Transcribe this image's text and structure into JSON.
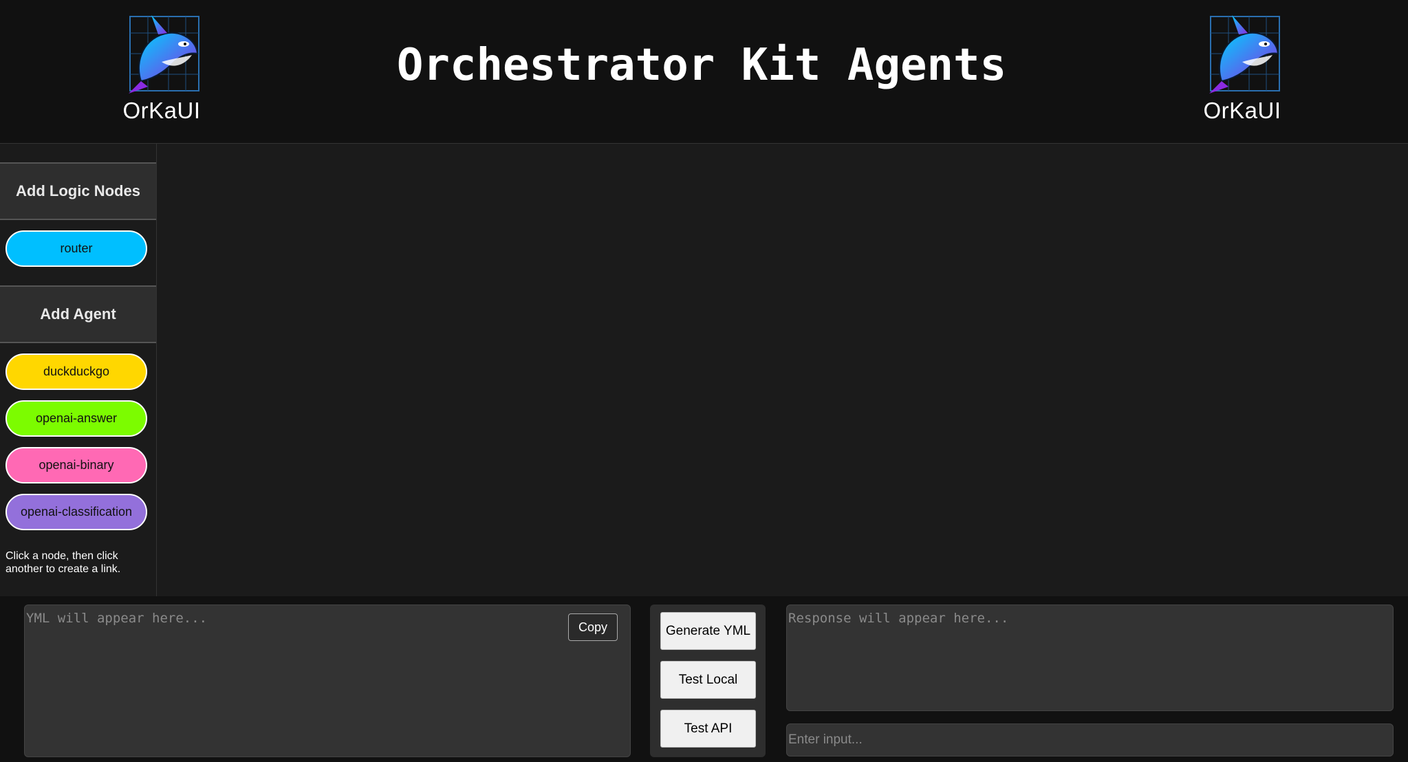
{
  "header": {
    "title": "Orchestrator Kit Agents",
    "logo_text": "OrKaUI",
    "logo_icon": "orca-whale-icon"
  },
  "sidebar": {
    "logic_heading": "Add Logic Nodes",
    "logic_nodes": [
      {
        "label": "router",
        "color": "#00bfff"
      }
    ],
    "agent_heading": "Add Agent",
    "agents": [
      {
        "label": "duckduckgo",
        "color": "#ffd700"
      },
      {
        "label": "openai-answer",
        "color": "#7cfc00"
      },
      {
        "label": "openai-binary",
        "color": "#ff69b4"
      },
      {
        "label": "openai-classification",
        "color": "#9370db"
      }
    ],
    "hint": "Click a node, then click another to create a link."
  },
  "bottom": {
    "yml_placeholder": "YML will appear here...",
    "copy_label": "Copy",
    "actions": [
      "Generate YML",
      "Test Local",
      "Test API"
    ],
    "response_placeholder": "Response will appear here...",
    "input_placeholder": "Enter input..."
  },
  "colors": {
    "background": "#111111",
    "canvas": "#1b1b1b",
    "panel": "#333333"
  }
}
